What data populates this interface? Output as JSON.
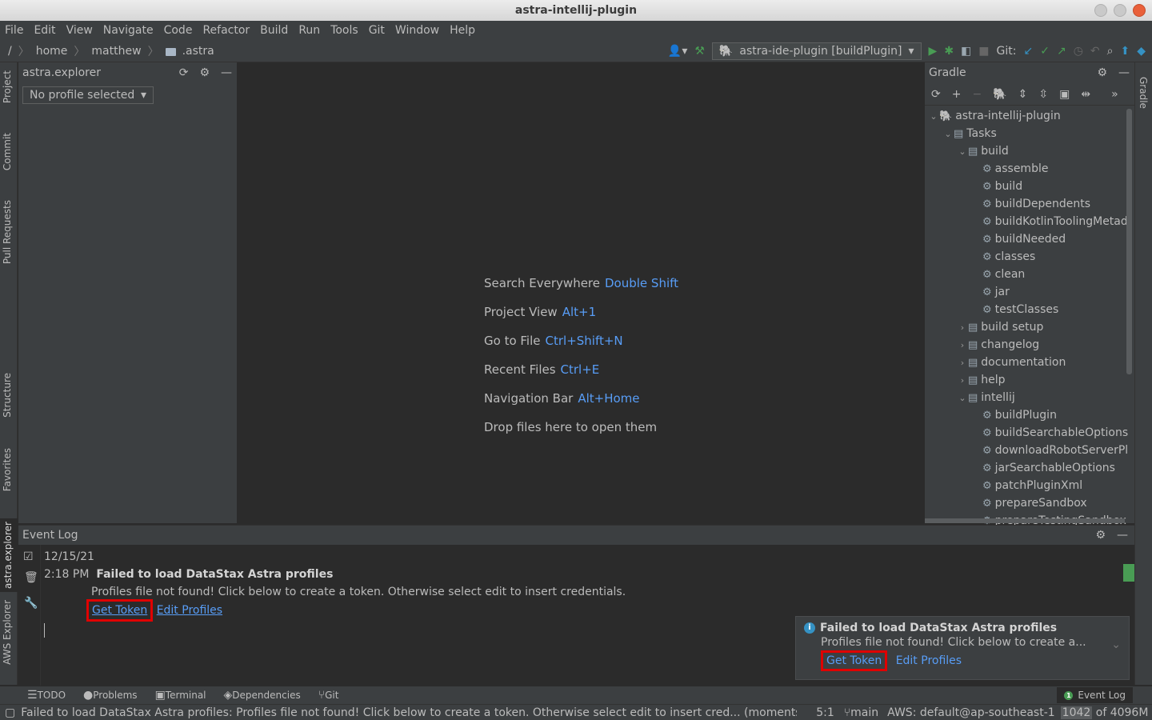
{
  "window": {
    "title": "astra-intellij-plugin"
  },
  "menu": [
    "File",
    "Edit",
    "View",
    "Navigate",
    "Code",
    "Refactor",
    "Build",
    "Run",
    "Tools",
    "Git",
    "Window",
    "Help"
  ],
  "breadcrumb": {
    "root": "/",
    "items": [
      "home",
      "matthew",
      ".astra"
    ]
  },
  "toolbar": {
    "run_config": "astra-ide-plugin [buildPlugin]",
    "git_label": "Git:"
  },
  "left_tabs": [
    "Project",
    "Commit",
    "Pull Requests",
    "Structure",
    "Favorites",
    "astra.explorer",
    "AWS Explorer"
  ],
  "right_tabs": [
    "Gradle"
  ],
  "explorer": {
    "title": "astra.explorer",
    "profile_combo": "No profile selected"
  },
  "editor_hints": [
    {
      "label": "Search Everywhere",
      "key": "Double Shift"
    },
    {
      "label": "Project View",
      "key": "Alt+1"
    },
    {
      "label": "Go to File",
      "key": "Ctrl+Shift+N"
    },
    {
      "label": "Recent Files",
      "key": "Ctrl+E"
    },
    {
      "label": "Navigation Bar",
      "key": "Alt+Home"
    },
    {
      "label": "Drop files here to open them",
      "key": ""
    }
  ],
  "gradle": {
    "title": "Gradle",
    "tree": [
      {
        "label": "astra-intellij-plugin",
        "depth": 0,
        "arrow": "v",
        "kind": "project"
      },
      {
        "label": "Tasks",
        "depth": 1,
        "arrow": "v",
        "kind": "folder"
      },
      {
        "label": "build",
        "depth": 2,
        "arrow": "v",
        "kind": "folder"
      },
      {
        "label": "assemble",
        "depth": 3,
        "arrow": "",
        "kind": "task"
      },
      {
        "label": "build",
        "depth": 3,
        "arrow": "",
        "kind": "task"
      },
      {
        "label": "buildDependents",
        "depth": 3,
        "arrow": "",
        "kind": "task"
      },
      {
        "label": "buildKotlinToolingMetad",
        "depth": 3,
        "arrow": "",
        "kind": "task"
      },
      {
        "label": "buildNeeded",
        "depth": 3,
        "arrow": "",
        "kind": "task"
      },
      {
        "label": "classes",
        "depth": 3,
        "arrow": "",
        "kind": "task"
      },
      {
        "label": "clean",
        "depth": 3,
        "arrow": "",
        "kind": "task"
      },
      {
        "label": "jar",
        "depth": 3,
        "arrow": "",
        "kind": "task"
      },
      {
        "label": "testClasses",
        "depth": 3,
        "arrow": "",
        "kind": "task"
      },
      {
        "label": "build setup",
        "depth": 2,
        "arrow": ">",
        "kind": "folder"
      },
      {
        "label": "changelog",
        "depth": 2,
        "arrow": ">",
        "kind": "folder"
      },
      {
        "label": "documentation",
        "depth": 2,
        "arrow": ">",
        "kind": "folder"
      },
      {
        "label": "help",
        "depth": 2,
        "arrow": ">",
        "kind": "folder"
      },
      {
        "label": "intellij",
        "depth": 2,
        "arrow": "v",
        "kind": "folder"
      },
      {
        "label": "buildPlugin",
        "depth": 3,
        "arrow": "",
        "kind": "task"
      },
      {
        "label": "buildSearchableOptions",
        "depth": 3,
        "arrow": "",
        "kind": "task"
      },
      {
        "label": "downloadRobotServerPl",
        "depth": 3,
        "arrow": "",
        "kind": "task"
      },
      {
        "label": "jarSearchableOptions",
        "depth": 3,
        "arrow": "",
        "kind": "task"
      },
      {
        "label": "patchPluginXml",
        "depth": 3,
        "arrow": "",
        "kind": "task"
      },
      {
        "label": "prepareSandbox",
        "depth": 3,
        "arrow": "",
        "kind": "task"
      },
      {
        "label": "prepareTestingSandbox",
        "depth": 3,
        "arrow": "",
        "kind": "task"
      }
    ]
  },
  "event_log": {
    "title": "Event Log",
    "date": "12/15/21",
    "time": "2:18 PM",
    "headline": "Failed to load DataStax Astra profiles",
    "message": "Profiles file not found! Click below to create a token. Otherwise select edit to insert credentials.",
    "link_get_token": "Get Token",
    "link_edit_profiles": "Edit Profiles"
  },
  "balloon": {
    "title": "Failed to load DataStax Astra profiles",
    "message": "Profiles file not found! Click below to create a...",
    "link_get_token": "Get Token",
    "link_edit_profiles": "Edit Profiles"
  },
  "bottom_tabs": [
    "TODO",
    "Problems",
    "Terminal",
    "Dependencies",
    "Git"
  ],
  "bottom_right_tab": "Event Log",
  "status": {
    "message": "Failed to load DataStax Astra profiles: Profiles file not found! Click below to create a token. Otherwise select edit to insert cred... (moments ago)",
    "position": "5:1",
    "branch": "main",
    "aws": "AWS: default@ap-southeast-1",
    "memory_used": "1042",
    "memory_total": " of 4096M"
  },
  "colors": {
    "accent": "#589df6",
    "highlight_box": "#e00000",
    "run_green": "#499c54"
  }
}
